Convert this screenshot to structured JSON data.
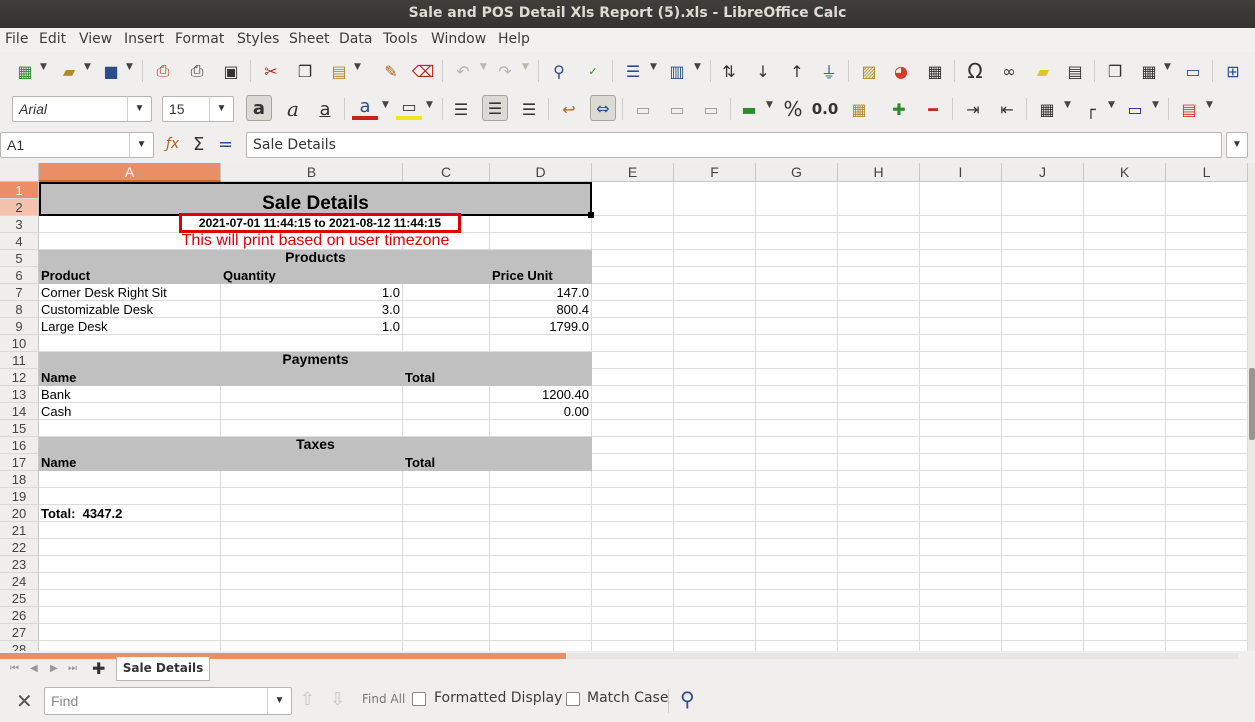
{
  "window": {
    "title": "Sale and POS Detail Xls Report (5).xls - LibreOffice Calc"
  },
  "menu": [
    "File",
    "Edit",
    "View",
    "Insert",
    "Format",
    "Styles",
    "Sheet",
    "Data",
    "Tools",
    "Window",
    "Help"
  ],
  "format_toolbar": {
    "font_name": "Arial",
    "font_size": "15",
    "percent_label": "%",
    "decimal_label": "0.0"
  },
  "formula_bar": {
    "cell_ref": "A1",
    "content": "Sale Details"
  },
  "columns": [
    "A",
    "B",
    "C",
    "D",
    "E",
    "F",
    "G",
    "H",
    "I",
    "J",
    "K",
    "L"
  ],
  "rows": [
    "1",
    "2",
    "3",
    "4",
    "5",
    "6",
    "7",
    "8",
    "9",
    "10",
    "11",
    "12",
    "13",
    "14",
    "15",
    "16",
    "17",
    "18",
    "19",
    "20",
    "21",
    "22",
    "23",
    "24",
    "25",
    "26",
    "27",
    "28"
  ],
  "report": {
    "title": "Sale Details",
    "date_range": "2021-07-01 11:44:15 to 2021-08-12 11:44:15",
    "note": "This will print based on user timezone",
    "products_header": "Products",
    "products_columns": {
      "product": "Product",
      "quantity": "Quantity",
      "price_unit": "Price Unit"
    },
    "products": [
      {
        "name": "Corner Desk Right Sit",
        "qty": "1.0",
        "price": "147.0"
      },
      {
        "name": "Customizable Desk",
        "qty": "3.0",
        "price": "800.4"
      },
      {
        "name": "Large Desk",
        "qty": "1.0",
        "price": "1799.0"
      }
    ],
    "payments_header": "Payments",
    "payments_columns": {
      "name": "Name",
      "total": "Total"
    },
    "payments": [
      {
        "name": "Bank",
        "total": "1200.40"
      },
      {
        "name": "Cash",
        "total": "0.00"
      }
    ],
    "taxes_header": "Taxes",
    "taxes_columns": {
      "name": "Name",
      "total": "Total"
    },
    "grand_total": "Total:  4347.2"
  },
  "sheet_tabs": {
    "active": "Sale Details"
  },
  "find_bar": {
    "placeholder": "Find",
    "find_all": "Find All",
    "formatted_display": "Formatted Display",
    "match_case": "Match Case"
  },
  "colors": {
    "note_red": "#e00000",
    "highlight_box": "#e00000",
    "header_grey": "#c0c0c0",
    "selected_header": "#e98e66",
    "titlebar": "#3c3b37"
  }
}
